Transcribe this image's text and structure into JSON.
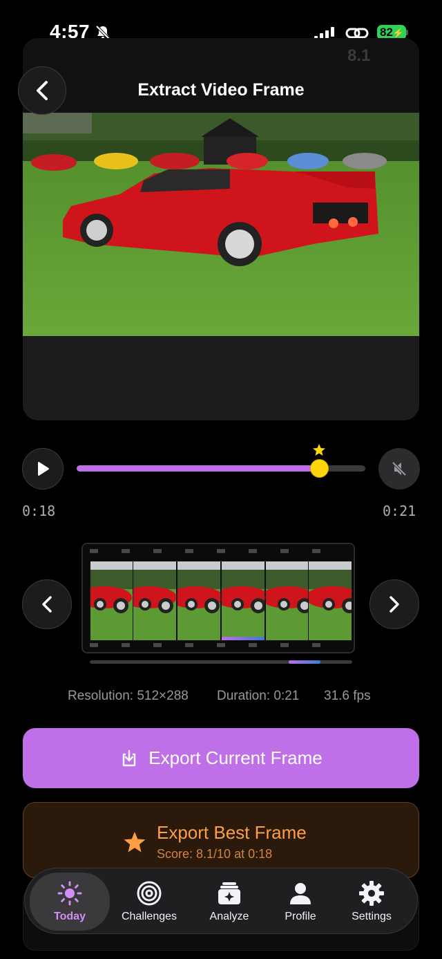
{
  "status_bar": {
    "time": "4:57",
    "battery": "82"
  },
  "header": {
    "title": "Extract Video Frame"
  },
  "video": {
    "overlay_score": "8.1"
  },
  "playback": {
    "current_time": "0:18",
    "duration_time": "0:21",
    "progress": 0.84,
    "best_frame_position": 0.84
  },
  "meta": {
    "resolution": "Resolution: 512×288",
    "duration": "Duration: 0:21",
    "fps": "31.6 fps"
  },
  "actions": {
    "export_current": "Export Current Frame",
    "export_best": "Export Best Frame",
    "best_score": "Score: 8.1/10 at 0:18"
  },
  "tabs": [
    {
      "label": "Today",
      "icon": "sun-icon",
      "active": true
    },
    {
      "label": "Challenges",
      "icon": "target-icon",
      "active": false
    },
    {
      "label": "Analyze",
      "icon": "photo-stack-sparkle-icon",
      "active": false
    },
    {
      "label": "Profile",
      "icon": "person-icon",
      "active": false
    },
    {
      "label": "Settings",
      "icon": "gear-icon",
      "active": false
    }
  ],
  "colors": {
    "accent": "#bf6fe8",
    "best": "#ff9f43",
    "thumb": "#ffd60a",
    "battery": "#30d158"
  }
}
